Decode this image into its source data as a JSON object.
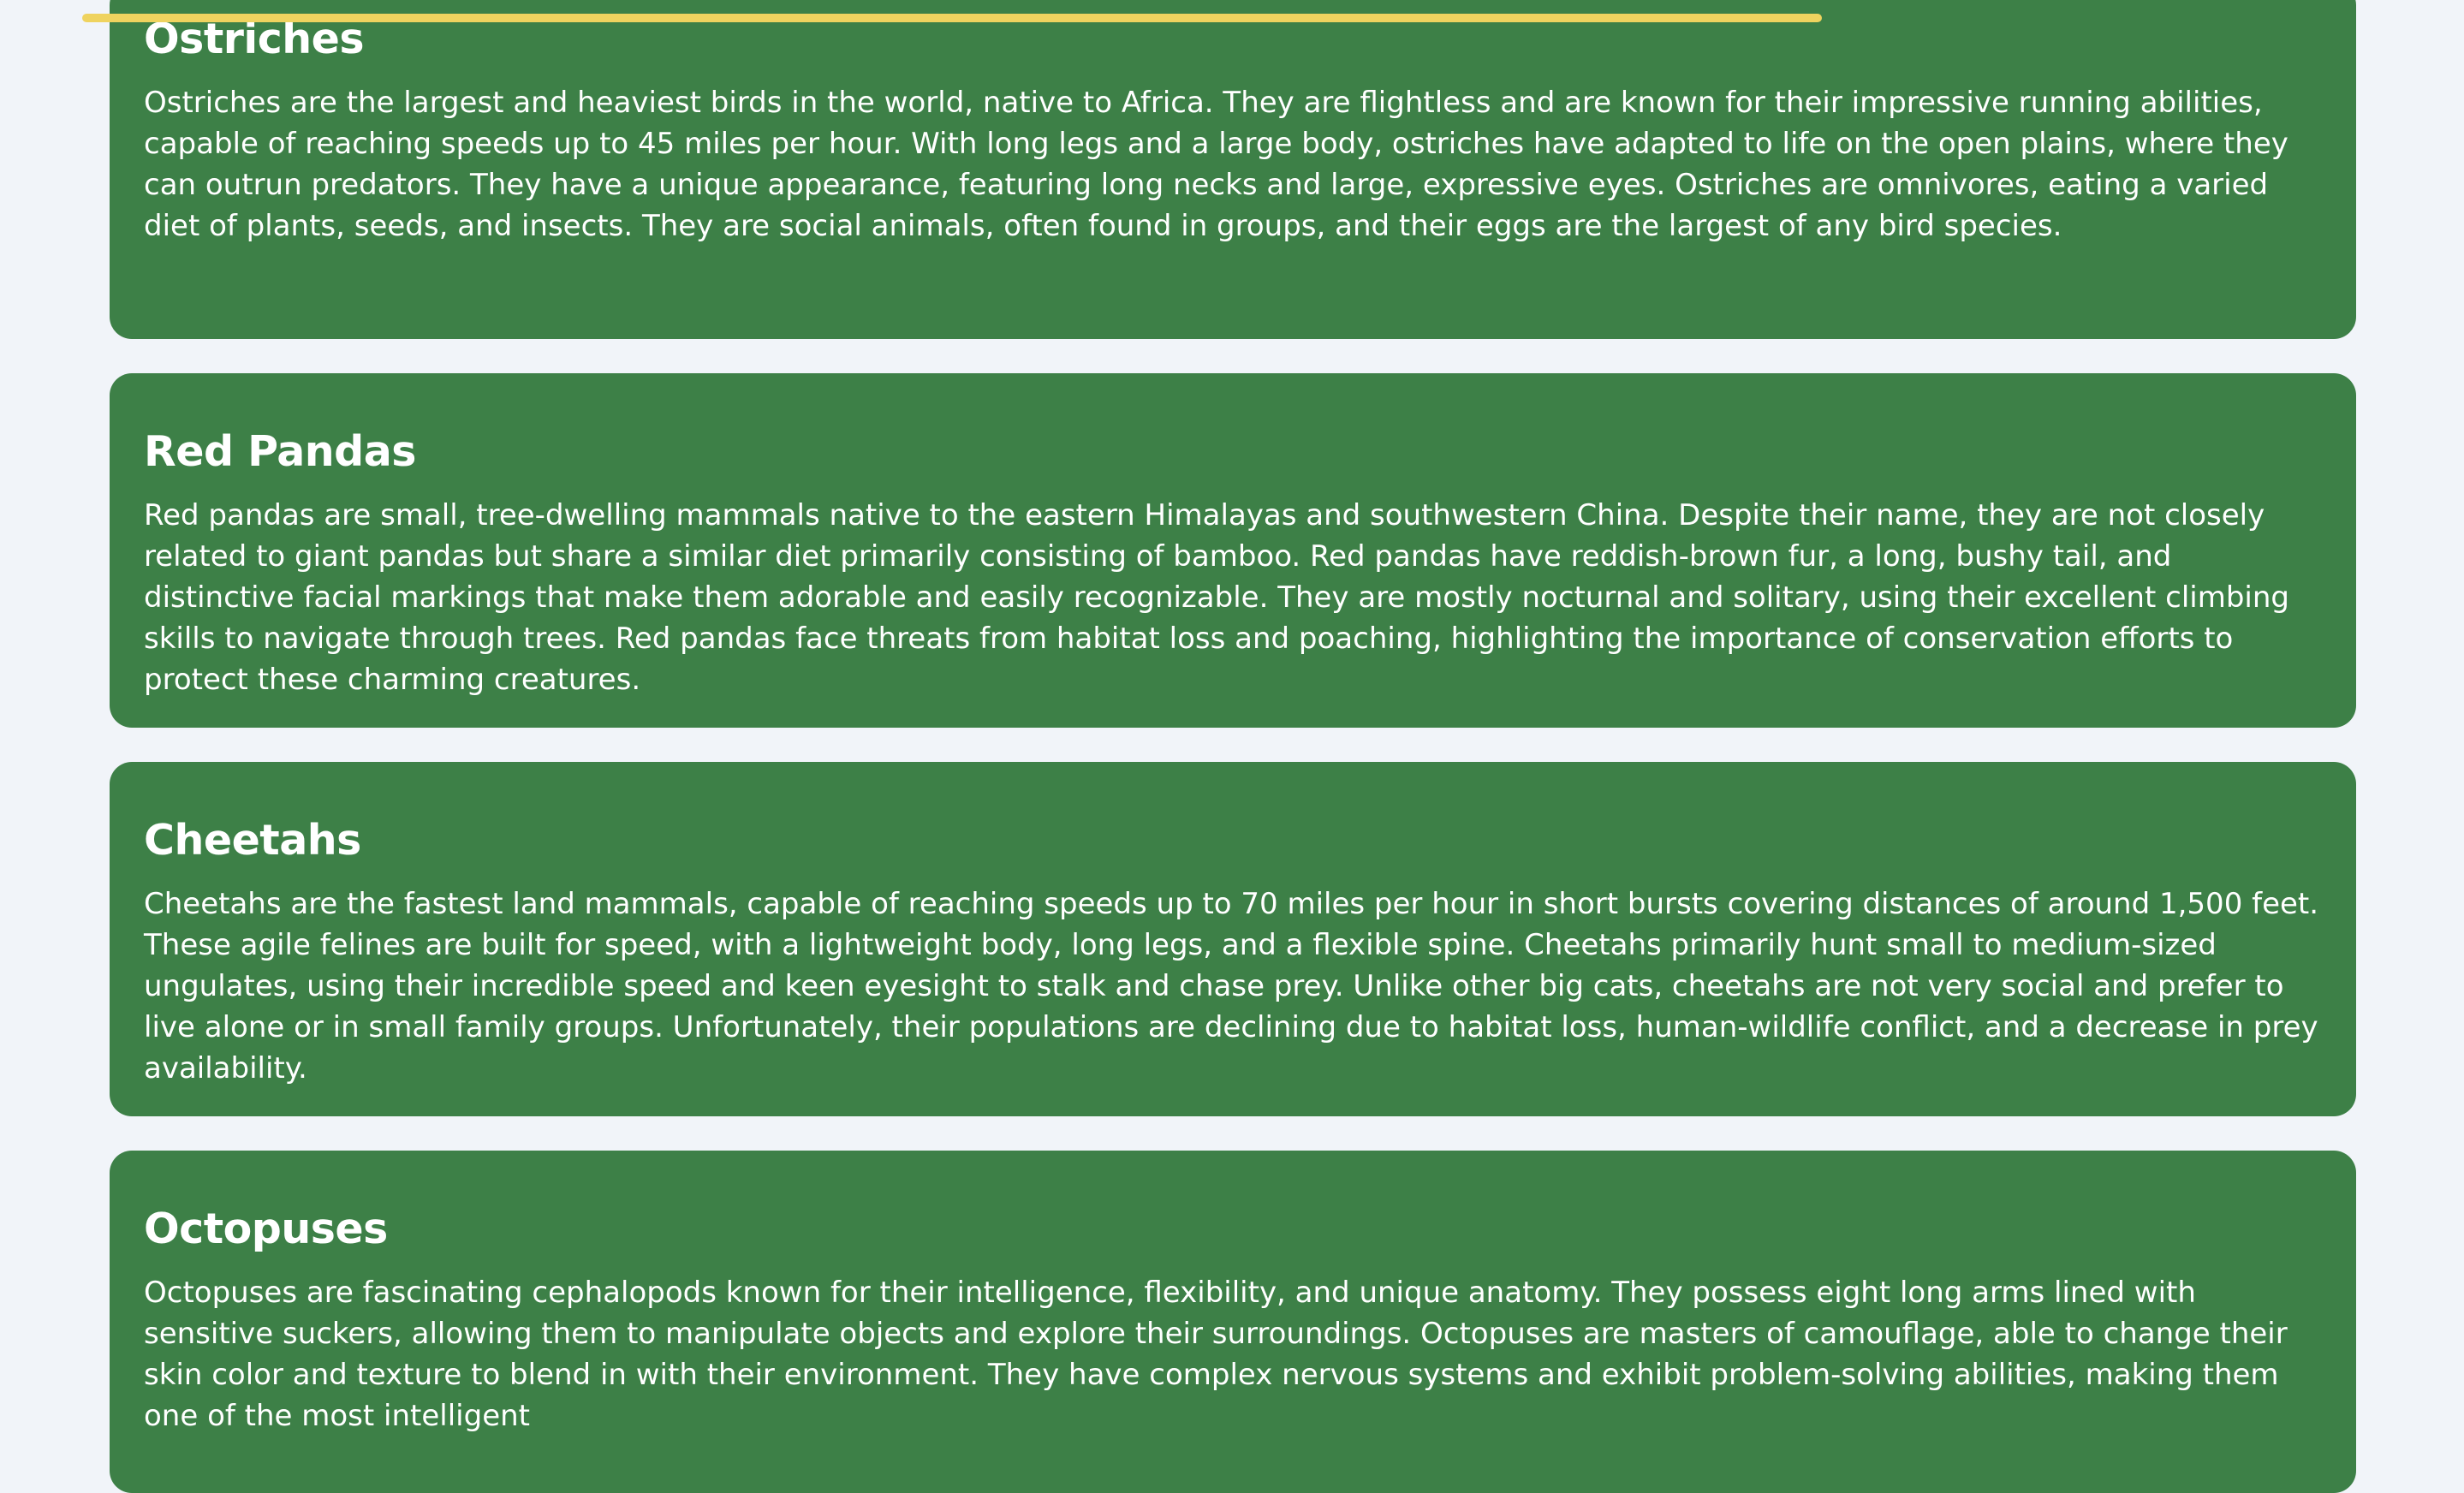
{
  "progress": {
    "fraction": 0.7,
    "color": "#efd35f"
  },
  "colors": {
    "background": "#f1f4f9",
    "card": "#3d8047",
    "text": "#ffffff"
  },
  "cards": [
    {
      "title": "Ostriches",
      "body": "Ostriches are the largest and heaviest birds in the world, native to Africa. They are flightless and are known for their impressive running abilities, capable of reaching speeds up to 45 miles per hour. With long legs and a large body, ostriches have adapted to life on the open plains, where they can outrun predators. They have a unique appearance, featuring long necks and large, expressive eyes. Ostriches are omnivores, eating a varied diet of plants, seeds, and insects. They are social animals, often found in groups, and their eggs are the largest of any bird species."
    },
    {
      "title": "Red Pandas",
      "body": "Red pandas are small, tree-dwelling mammals native to the eastern Himalayas and southwestern China. Despite their name, they are not closely related to giant pandas but share a similar diet primarily consisting of bamboo. Red pandas have reddish-brown fur, a long, bushy tail, and distinctive facial markings that make them adorable and easily recognizable. They are mostly nocturnal and solitary, using their excellent climbing skills to navigate through trees. Red pandas face threats from habitat loss and poaching, highlighting the importance of conservation efforts to protect these charming creatures."
    },
    {
      "title": "Cheetahs",
      "body": "Cheetahs are the fastest land mammals, capable of reaching speeds up to 70 miles per hour in short bursts covering distances of around 1,500 feet. These agile felines are built for speed, with a lightweight body, long legs, and a flexible spine. Cheetahs primarily hunt small to medium-sized ungulates, using their incredible speed and keen eyesight to stalk and chase prey. Unlike other big cats, cheetahs are not very social and prefer to live alone or in small family groups. Unfortunately, their populations are declining due to habitat loss, human-wildlife conflict, and a decrease in prey availability."
    },
    {
      "title": "Octopuses",
      "body": "Octopuses are fascinating cephalopods known for their intelligence, flexibility, and unique anatomy. They possess eight long arms lined with sensitive suckers, allowing them to manipulate objects and explore their surroundings. Octopuses are masters of camouflage, able to change their skin color and texture to blend in with their environment. They have complex nervous systems and exhibit problem-solving abilities, making them one of the most intelligent"
    }
  ]
}
